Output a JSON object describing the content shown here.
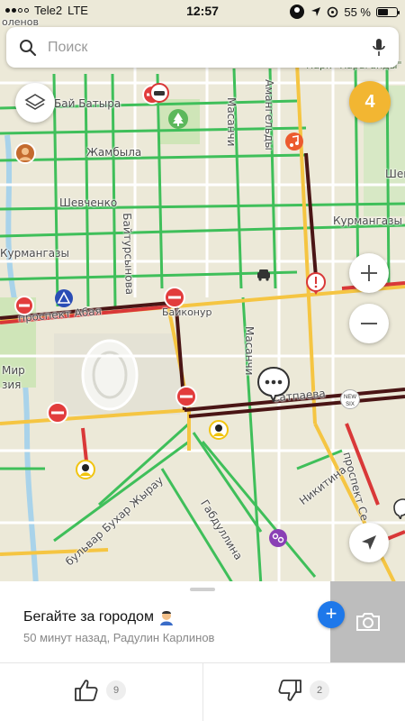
{
  "status_bar": {
    "carrier": "Tele2",
    "network": "LTE",
    "time": "12:57",
    "battery_percent": "55 %",
    "battery_level": 0.55
  },
  "search": {
    "placeholder": "Поиск",
    "icon": "search-icon",
    "mic_icon": "microphone-icon"
  },
  "map": {
    "traffic_level": "4",
    "traffic_color": "#f2b632",
    "streets": {
      "top_left": "оленов",
      "park": "Парк \"Караганды\"",
      "baybatyra": "Бай Батыра",
      "zhambyla": "Жамбыла",
      "shevchenko": "Шевченко",
      "kurmangazy_right": "Курмангазы",
      "kurmangazy_left": "Курмангазы",
      "baytursynova": "Байтурсынова",
      "magnsha": "Масанчи",
      "amangeldy": "Амангельды",
      "masanchi2": "Масанчи",
      "shevch_right": "Шев",
      "prospect_abaya": "проспект Абая",
      "baikonur": "Байконур",
      "mir": "Мир",
      "zia": "зия",
      "satpaeva": "Сатпаева",
      "bukhar": "бульвар Бухар Жырау",
      "gabdulina": "Габдуллина",
      "nikitina": "Никитина",
      "prospect_right": "проспект Се"
    },
    "new_six_badge": "NEW SIX"
  },
  "event": {
    "title": "Бегайте за городом",
    "time_ago": "50 минут назад",
    "author": "Радулин Карлинов",
    "meta_separator": ", "
  },
  "votes": {
    "likes": "9",
    "dislikes": "2"
  },
  "colors": {
    "road_green": "#3fbf5a",
    "road_yellow": "#f5c542",
    "road_red": "#d93838",
    "road_dark": "#4a1515",
    "accent_blue": "#1e78ea"
  }
}
